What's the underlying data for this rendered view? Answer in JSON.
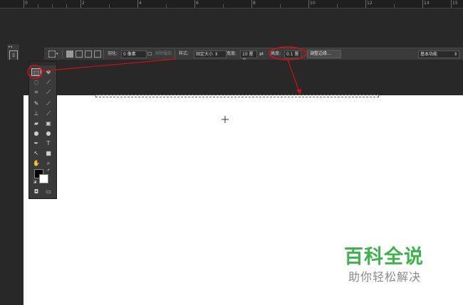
{
  "ruler": {
    "labels": [
      "0",
      "2",
      "4",
      "6",
      "8",
      "10",
      "12",
      "14",
      "15"
    ]
  },
  "options_bar": {
    "feather_label": "羽化:",
    "feather_value": "0 像素",
    "antialias_label": "消除锯齿",
    "style_label": "样式:",
    "style_value": "固定大小",
    "width_label": "宽度:",
    "width_value": "10 厘米",
    "swap_icon": "swap-arrows-icon",
    "height_label": "高度:",
    "height_value": "0.1 厘",
    "refine_edge_button": "调整边缘...",
    "workspace_value": "基本功能"
  },
  "watermark": {
    "title": "百科全说",
    "subtitle": "助你轻松解决"
  },
  "colors": {
    "annotation_red": "#d01010",
    "watermark_green": "#3bb54a",
    "canvas": "#ffffff",
    "workspace": "#282828"
  }
}
